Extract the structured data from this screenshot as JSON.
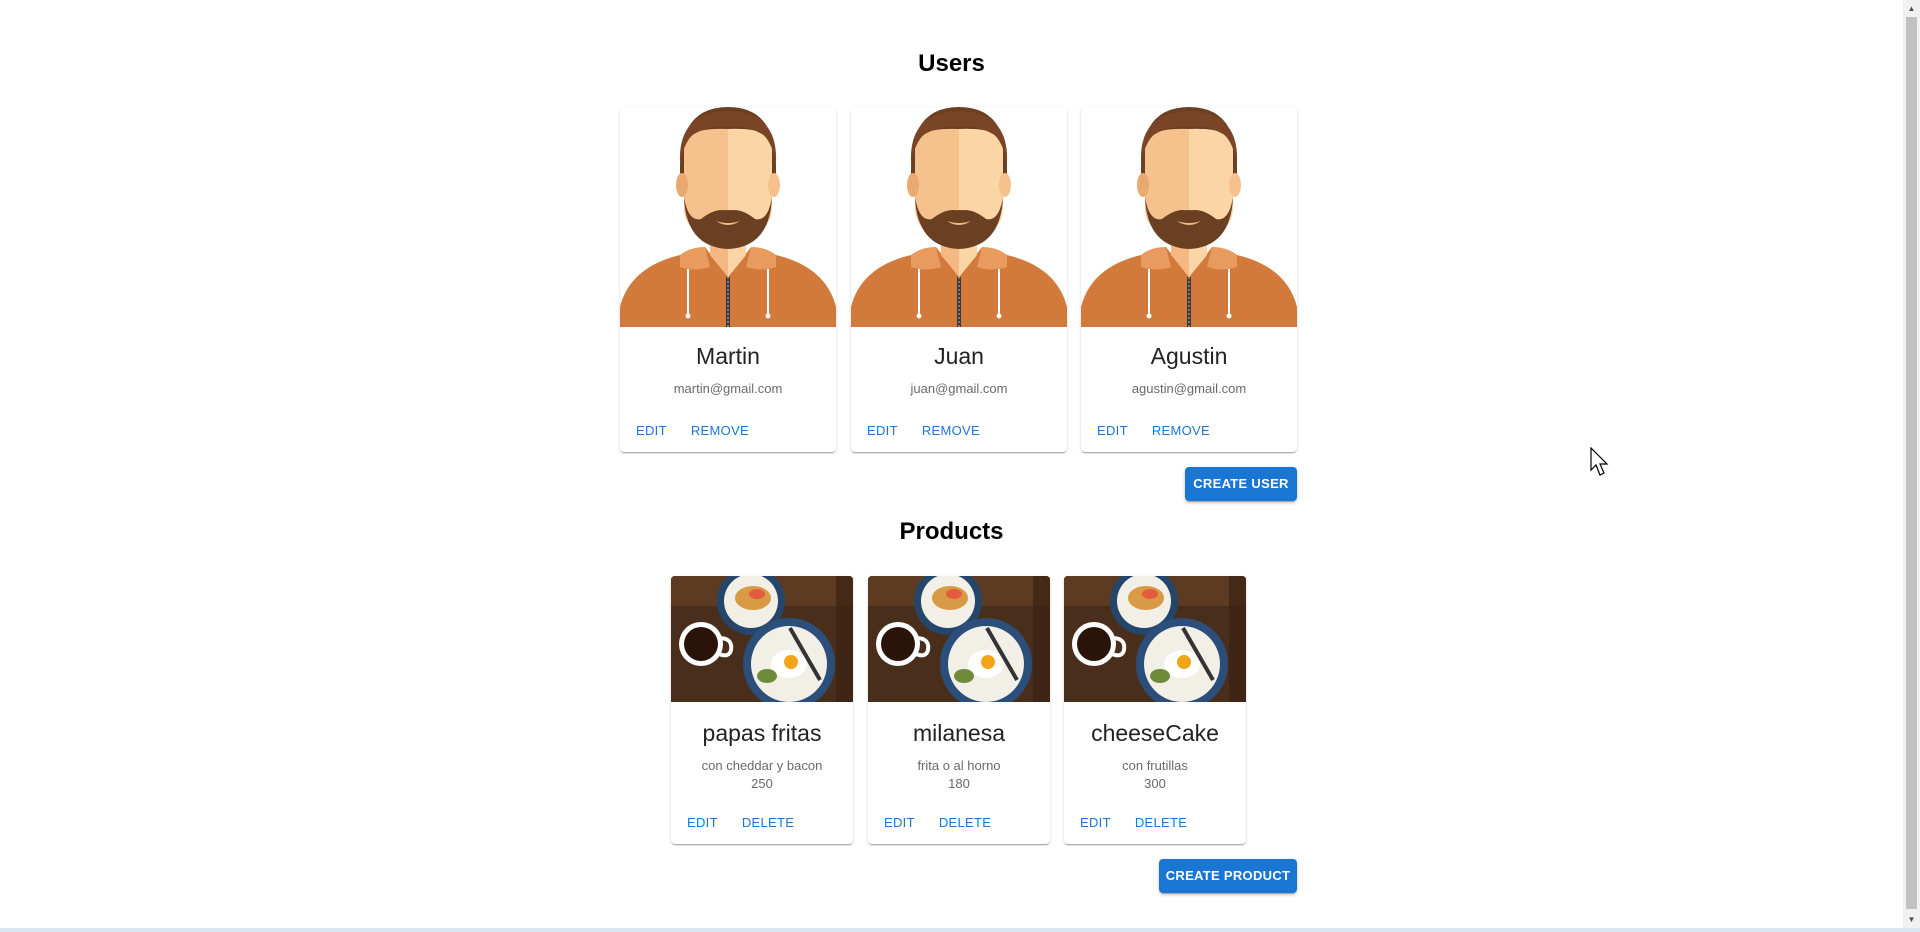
{
  "users_section": {
    "title": "Users",
    "create_button": "CREATE USER",
    "edit_label": "EDIT",
    "remove_label": "REMOVE",
    "users": [
      {
        "name": "Martin",
        "email": "martin@gmail.com"
      },
      {
        "name": "Juan",
        "email": "juan@gmail.com"
      },
      {
        "name": "Agustin",
        "email": "agustin@gmail.com"
      }
    ]
  },
  "products_section": {
    "title": "Products",
    "create_button": "CREATE PRODUCT",
    "edit_label": "EDIT",
    "delete_label": "DELETE",
    "products": [
      {
        "name": "papas fritas",
        "description": "con cheddar y bacon",
        "price": "250"
      },
      {
        "name": "milanesa",
        "description": "frita o al horno",
        "price": "180"
      },
      {
        "name": "cheeseCake",
        "description": "con frutillas",
        "price": "300"
      }
    ]
  },
  "colors": {
    "primary": "#1976d2",
    "hoodie": "#d27a3c",
    "hair": "#6b3f22",
    "skin": "#fbd5a6"
  }
}
